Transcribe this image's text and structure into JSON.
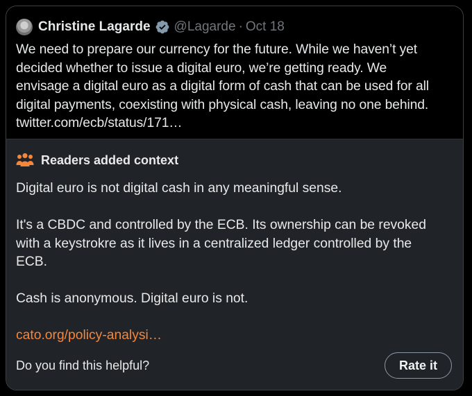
{
  "tweet": {
    "author": "Christine Lagarde",
    "handle": "@Lagarde",
    "separator": "·",
    "date": "Oct 18",
    "body_lines": [
      "We need to prepare our currency for the future. While we haven’t yet",
      "decided whether to issue a digital euro, we’re getting ready. We",
      "envisage a digital euro as a digital form of cash that can be used for all",
      "digital payments, coexisting with physical cash, leaving no one behind."
    ],
    "link": "twitter.com/ecb/status/171…",
    "icons": {
      "verified": "verified-badge-icon",
      "avatar": "avatar"
    }
  },
  "context": {
    "title": "Readers added context",
    "icon": "people-icon",
    "paragraph1": "Digital euro is not digital cash in any meaningful sense.",
    "paragraph2_lines": [
      "It's a CBDC and controlled by the ECB. Its ownership can be revoked",
      "with a keystrokre as it lives in a centralized ledger controlled by the",
      "ECB."
    ],
    "paragraph3": "Cash is anonymous. Digital euro is not.",
    "link": "cato.org/policy-analysi…",
    "helpful_question": "Do you find this helpful?",
    "rate_button": "Rate it",
    "colors": {
      "accent_link": "#f5873b",
      "icon": "#f5873b"
    }
  }
}
